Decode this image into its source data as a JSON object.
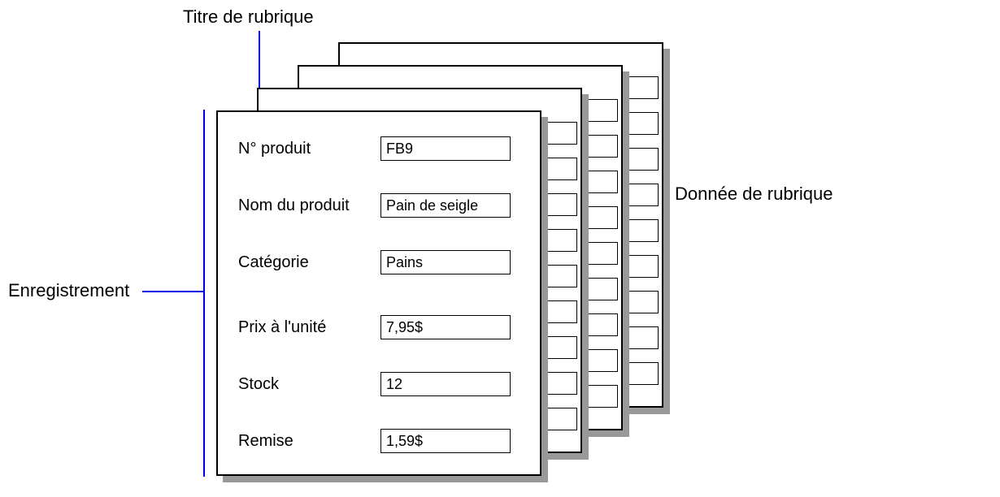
{
  "annotations": {
    "field_title": "Titre de rubrique",
    "record": "Enregistrement",
    "field_data": "Donnée de rubrique"
  },
  "fields": [
    {
      "label": "N° produit",
      "value": "FB9"
    },
    {
      "label": "Nom du produit",
      "value": "Pain de seigle"
    },
    {
      "label": "Catégorie",
      "value": "Pains"
    },
    {
      "label": "Prix à l'unité",
      "value": "7,95$"
    },
    {
      "label": "Stock",
      "value": "12"
    },
    {
      "label": "Remise",
      "value": "1,59$"
    }
  ],
  "callout_color": "#0000e6"
}
